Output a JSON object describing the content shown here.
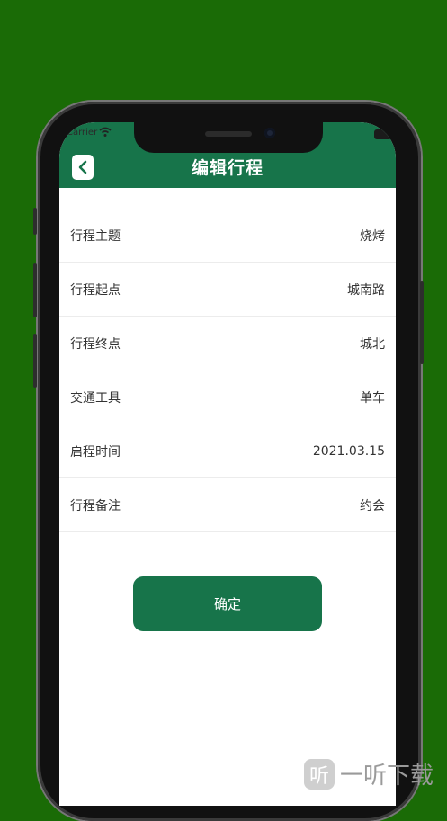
{
  "status_bar": {
    "carrier": "Carrier"
  },
  "header": {
    "title": "编辑行程"
  },
  "form": {
    "rows": [
      {
        "label": "行程主题",
        "value": "烧烤"
      },
      {
        "label": "行程起点",
        "value": "城南路"
      },
      {
        "label": "行程终点",
        "value": "城北"
      },
      {
        "label": "交通工具",
        "value": "单车"
      },
      {
        "label": "启程时间",
        "value": "2021.03.15"
      },
      {
        "label": "行程备注",
        "value": "约会"
      }
    ]
  },
  "actions": {
    "confirm_label": "确定"
  },
  "watermark": {
    "logo": "听",
    "text": "一听下载"
  },
  "colors": {
    "background": "#1a6b06",
    "accent": "#17744a"
  }
}
